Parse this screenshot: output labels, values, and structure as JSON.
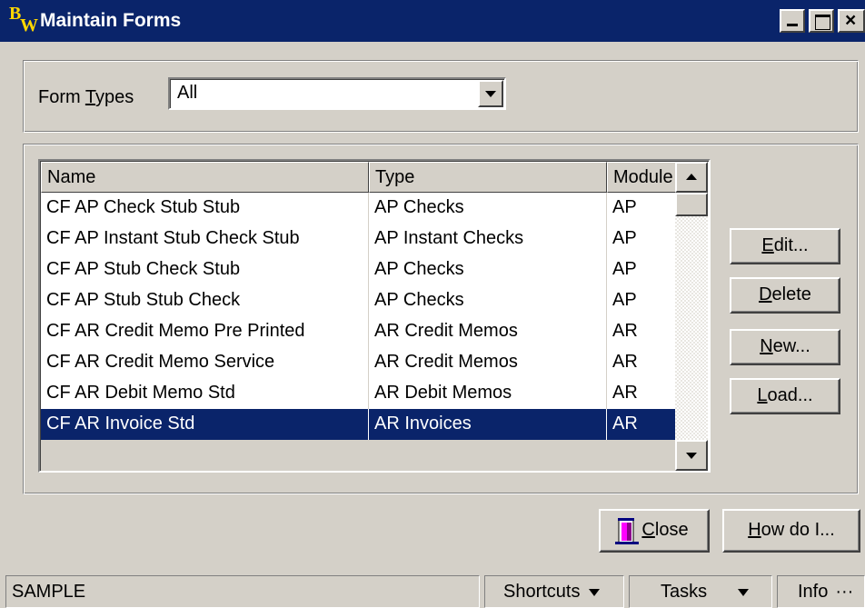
{
  "window": {
    "title": "Maintain Forms",
    "logo_b": "B",
    "logo_w": "W"
  },
  "filter": {
    "label_pre": "Form ",
    "label_mnemonic": "T",
    "label_post": "ypes",
    "value": "All"
  },
  "list": {
    "columns": [
      "Name",
      "Type",
      "Module"
    ],
    "rows": [
      [
        "CF AP Check Stub Stub",
        "AP Checks",
        "AP"
      ],
      [
        "CF AP Instant Stub Check Stub",
        "AP Instant Checks",
        "AP"
      ],
      [
        "CF AP Stub Check Stub",
        "AP Checks",
        "AP"
      ],
      [
        "CF AP Stub Stub Check",
        "AP Checks",
        "AP"
      ],
      [
        "CF AR Credit Memo Pre Printed",
        "AR Credit Memos",
        "AR"
      ],
      [
        "CF AR Credit Memo Service",
        "AR Credit Memos",
        "AR"
      ],
      [
        "CF AR Debit Memo Std",
        "AR Debit Memos",
        "AR"
      ],
      [
        "CF AR Invoice Std",
        "AR Invoices",
        "AR"
      ]
    ],
    "selected_index": 7
  },
  "buttons": {
    "edit": {
      "mnemonic": "E",
      "rest": "dit..."
    },
    "delete": {
      "mnemonic": "D",
      "rest": "elete"
    },
    "new": {
      "mnemonic": "N",
      "rest": "ew..."
    },
    "load": {
      "mnemonic": "L",
      "rest": "oad..."
    },
    "close": {
      "mnemonic": "C",
      "rest": "lose"
    },
    "howdo": {
      "mnemonic": "H",
      "rest": "ow do I..."
    }
  },
  "statusbar": {
    "sample": "SAMPLE",
    "shortcuts": "Shortcuts",
    "tasks": "Tasks",
    "info": "Info"
  },
  "colors": {
    "titlebar": "#0a246a",
    "selection": "#0a246a",
    "face": "#d4d0c8"
  }
}
